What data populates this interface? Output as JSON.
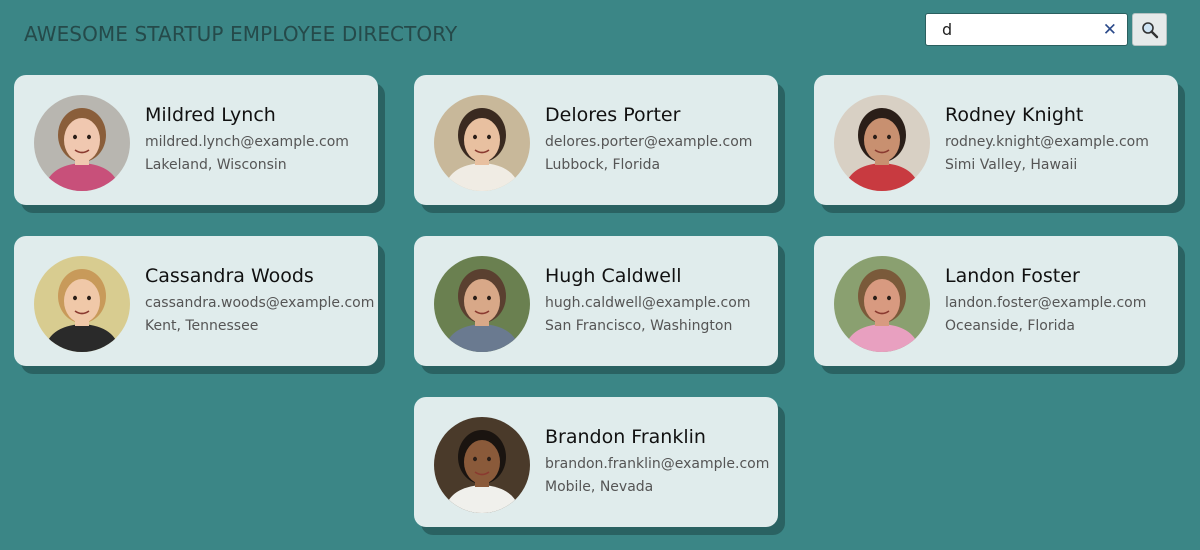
{
  "header": {
    "title": "AWESOME STARTUP EMPLOYEE DIRECTORY"
  },
  "search": {
    "value": "d",
    "clear_icon": "close-icon",
    "button_icon": "search-icon"
  },
  "employees": [
    {
      "name": "Mildred Lynch",
      "email": "mildred.lynch@example.com",
      "location": "Lakeland, Wisconsin",
      "avatar": {
        "bg": "#b8b6b0",
        "hair": "#8a5e3a",
        "skin": "#f0c8b0",
        "shirt": "#c8507a"
      }
    },
    {
      "name": "Delores Porter",
      "email": "delores.porter@example.com",
      "location": "Lubbock, Florida",
      "avatar": {
        "bg": "#c8b89a",
        "hair": "#3a2a20",
        "skin": "#e8c0a0",
        "shirt": "#f0ece4"
      }
    },
    {
      "name": "Rodney Knight",
      "email": "rodney.knight@example.com",
      "location": "Simi Valley, Hawaii",
      "avatar": {
        "bg": "#d8d0c4",
        "hair": "#2a1e18",
        "skin": "#c89070",
        "shirt": "#c83a40"
      }
    },
    {
      "name": "Cassandra Woods",
      "email": "cassandra.woods@example.com",
      "location": "Kent, Tennessee",
      "avatar": {
        "bg": "#d8cc90",
        "hair": "#c89a5a",
        "skin": "#f0c8a8",
        "shirt": "#2a2a2a"
      }
    },
    {
      "name": "Hugh Caldwell",
      "email": "hugh.caldwell@example.com",
      "location": "San Francisco, Washington",
      "avatar": {
        "bg": "#6a8050",
        "hair": "#5a4030",
        "skin": "#d8a888",
        "shirt": "#6a7a90"
      }
    },
    {
      "name": "Landon Foster",
      "email": "landon.foster@example.com",
      "location": "Oceanside, Florida",
      "avatar": {
        "bg": "#8aa070",
        "hair": "#7a5a3a",
        "skin": "#d89a80",
        "shirt": "#e8a0c0"
      }
    },
    {
      "name": "Brandon Franklin",
      "email": "brandon.franklin@example.com",
      "location": "Mobile, Nevada",
      "avatar": {
        "bg": "#4a3a2a",
        "hair": "#1a1410",
        "skin": "#8a5a3a",
        "shirt": "#f0f0ec"
      }
    }
  ]
}
